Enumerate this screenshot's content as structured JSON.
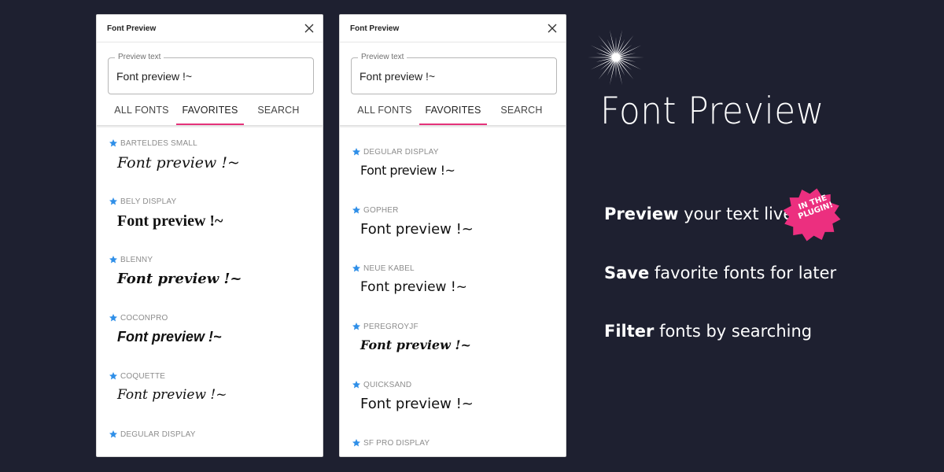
{
  "panels": [
    {
      "title": "Font Preview",
      "input_label": "Preview text",
      "input_value": "Font preview !~",
      "tabs": [
        "ALL FONTS",
        "FAVORITES",
        "SEARCH"
      ],
      "active_tab": "FAVORITES",
      "fonts": [
        {
          "name": "BARTELDES SMALL",
          "sample": "Font preview !~"
        },
        {
          "name": "BELY DISPLAY",
          "sample": "Font preview !~"
        },
        {
          "name": "BLENNY",
          "sample": "Font preview !~"
        },
        {
          "name": "COCONPRO",
          "sample": "Font preview !~"
        },
        {
          "name": "COQUETTE",
          "sample": "Font preview !~"
        },
        {
          "name": "DEGULAR DISPLAY",
          "sample": ""
        }
      ]
    },
    {
      "title": "Font Preview",
      "input_label": "Preview text",
      "input_value": "Font preview !~",
      "tabs": [
        "ALL FONTS",
        "FAVORITES",
        "SEARCH"
      ],
      "active_tab": "FAVORITES",
      "fonts": [
        {
          "name": "DEGULAR DISPLAY",
          "sample": "Font preview !~"
        },
        {
          "name": "GOPHER",
          "sample": "Font preview !~"
        },
        {
          "name": "NEUE KABEL",
          "sample": "Font preview !~"
        },
        {
          "name": "PEREGROYJF",
          "sample": "Font preview !~"
        },
        {
          "name": "QUICKSAND",
          "sample": "Font preview !~"
        },
        {
          "name": "SF PRO DISPLAY",
          "sample": ""
        }
      ]
    }
  ],
  "promo": {
    "brand": "Font Preview",
    "features": [
      {
        "bold": "Preview",
        "rest": " your text live"
      },
      {
        "bold": "Save",
        "rest": " favorite fonts for later"
      },
      {
        "bold": "Filter",
        "rest": " fonts by searching"
      }
    ],
    "badge_line1": "IN THE",
    "badge_line2": "PLUGIN!"
  },
  "colors": {
    "background": "#1e2030",
    "accent_tab": "#e5327a",
    "star": "#2f8fe8",
    "badge": "#ec2f7f"
  },
  "icons": {
    "close": "close-icon",
    "favorite": "star-icon",
    "sparkle": "sparkle-icon"
  }
}
